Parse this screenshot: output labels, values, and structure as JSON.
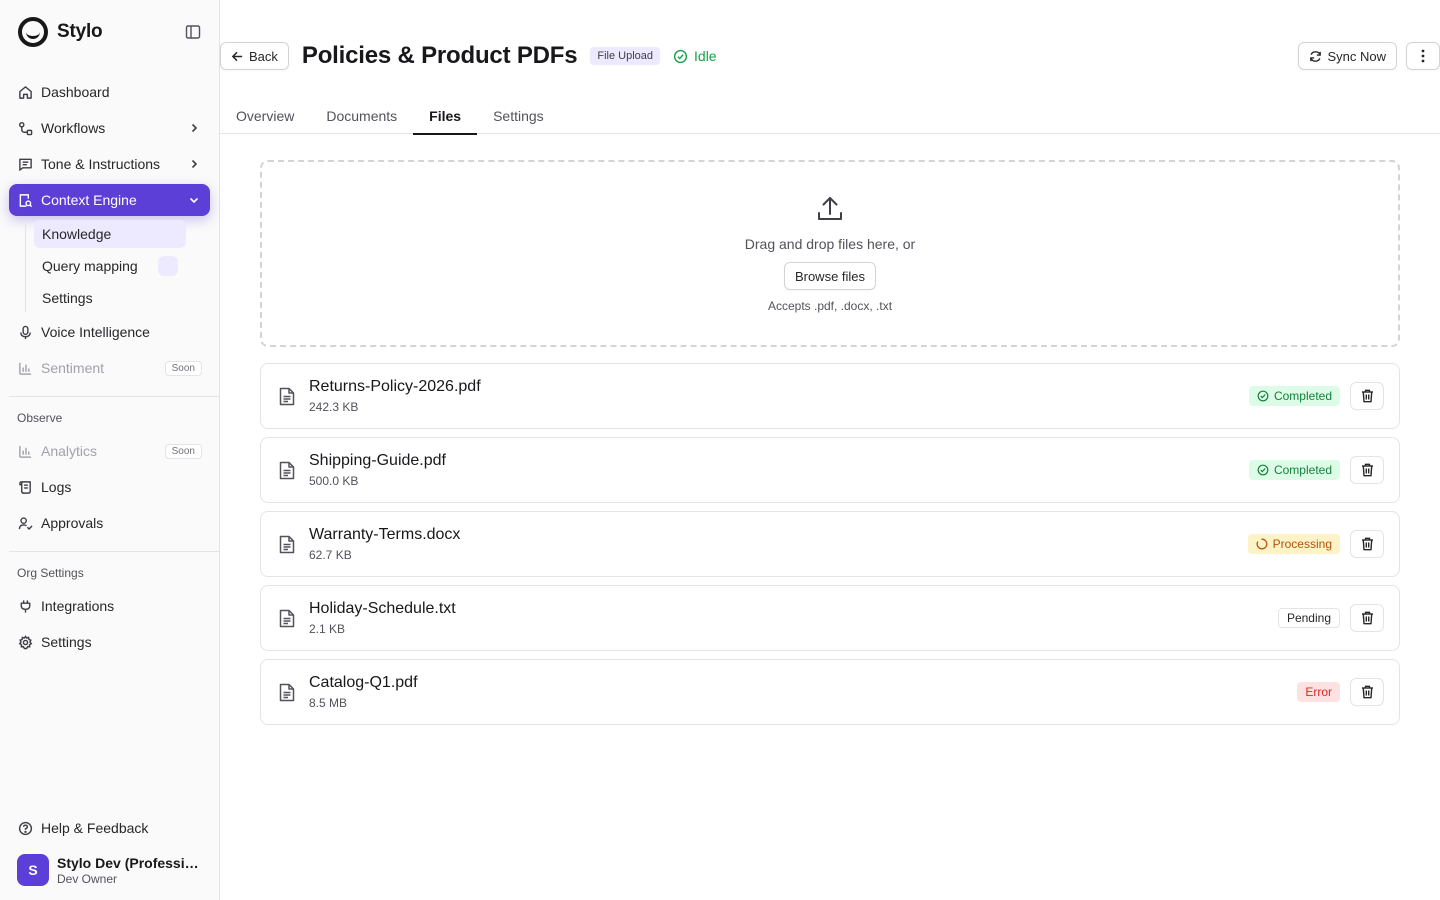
{
  "brand": {
    "name": "Stylo",
    "logo_icon": "stylo-logo-icon"
  },
  "sidebar": {
    "items": [
      {
        "label": "Dashboard",
        "icon": "home-icon"
      },
      {
        "label": "Workflows",
        "icon": "workflow-icon"
      },
      {
        "label": "Tone & Instructions",
        "icon": "message-square-icon"
      },
      {
        "label": "Context Engine",
        "icon": "search-document-icon"
      },
      {
        "label": "Voice Intelligence",
        "icon": "mic-icon"
      },
      {
        "label": "Sentiment",
        "icon": "bar-chart-icon",
        "tag": "Soon"
      }
    ],
    "context_engine_sub": [
      {
        "label": "Knowledge"
      },
      {
        "label": "Query mapping"
      },
      {
        "label": "Settings"
      }
    ],
    "observe_label": "Observe",
    "observe_items": [
      {
        "label": "Analytics",
        "icon": "bar-chart-icon",
        "tag": "Soon"
      },
      {
        "label": "Logs",
        "icon": "scroll-icon"
      },
      {
        "label": "Approvals",
        "icon": "user-check-icon"
      }
    ],
    "org_label": "Org Settings",
    "org_items": [
      {
        "label": "Integrations",
        "icon": "plug-icon"
      },
      {
        "label": "Settings",
        "icon": "gear-icon"
      }
    ],
    "help_label": "Help & Feedback",
    "user": {
      "initial": "S",
      "name": "Stylo Dev (Professio...",
      "role": "Dev Owner"
    }
  },
  "header": {
    "back_label": "Back",
    "title": "Policies & Product PDFs",
    "type_badge": "File Upload",
    "status": "Idle",
    "sync_label": "Sync Now"
  },
  "tabs": [
    {
      "label": "Overview"
    },
    {
      "label": "Documents"
    },
    {
      "label": "Files",
      "active": true
    },
    {
      "label": "Settings"
    }
  ],
  "dropzone": {
    "text": "Drag and drop files here, or",
    "button_label": "Browse files",
    "accepts": "Accepts .pdf, .docx, .txt"
  },
  "files": [
    {
      "name": "Returns-Policy-2026.pdf",
      "size": "242.3 KB",
      "status": "Completed",
      "status_key": "completed"
    },
    {
      "name": "Shipping-Guide.pdf",
      "size": "500.0 KB",
      "status": "Completed",
      "status_key": "completed"
    },
    {
      "name": "Warranty-Terms.docx",
      "size": "62.7 KB",
      "status": "Processing",
      "status_key": "processing"
    },
    {
      "name": "Holiday-Schedule.txt",
      "size": "2.1 KB",
      "status": "Pending",
      "status_key": "pending"
    },
    {
      "name": "Catalog-Q1.pdf",
      "size": "8.5 MB",
      "status": "Error",
      "status_key": "error"
    }
  ],
  "colors": {
    "accent": "#5b3fd6",
    "accent_soft": "#ede9fe",
    "success": "#16a34a",
    "warning": "#b45309",
    "error": "#dc2626"
  }
}
